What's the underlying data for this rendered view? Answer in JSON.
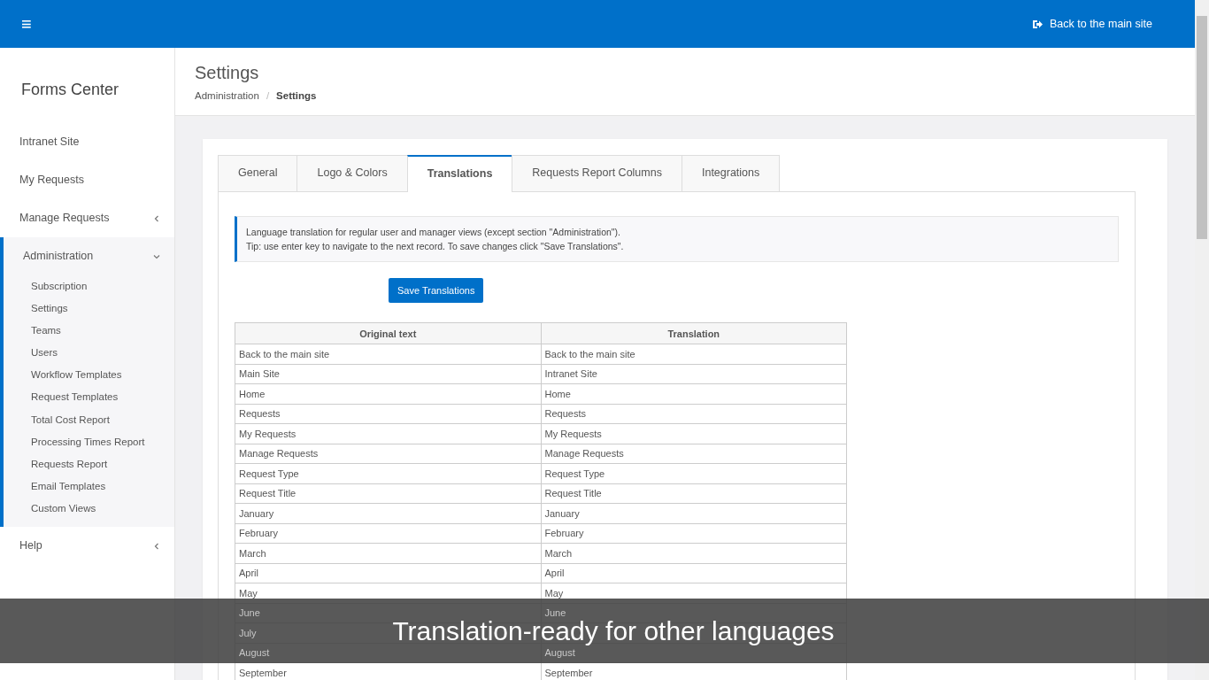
{
  "topbar": {
    "menu_icon": "≡",
    "back_link": "Back to the main site"
  },
  "sidebar": {
    "brand": "Forms Center",
    "items": [
      {
        "label": "Intranet Site",
        "expandable": false,
        "expanded": false
      },
      {
        "label": "My Requests",
        "expandable": false,
        "expanded": false
      },
      {
        "label": "Manage Requests",
        "expandable": true,
        "expanded": false
      },
      {
        "label": "Administration",
        "expandable": true,
        "expanded": true,
        "children": [
          {
            "label": "Subscription"
          },
          {
            "label": "Settings"
          },
          {
            "label": "Teams"
          },
          {
            "label": "Users"
          },
          {
            "label": "Workflow Templates"
          },
          {
            "label": "Request Templates"
          },
          {
            "label": "Total Cost Report"
          },
          {
            "label": "Processing Times Report"
          },
          {
            "label": "Requests Report"
          },
          {
            "label": "Email Templates"
          },
          {
            "label": "Custom Views"
          }
        ]
      },
      {
        "label": "Help",
        "expandable": true,
        "expanded": false
      }
    ]
  },
  "page": {
    "title": "Settings",
    "breadcrumb_separator": "/",
    "breadcrumb": [
      {
        "label": "Administration",
        "current": false
      },
      {
        "label": "Settings",
        "current": true
      }
    ]
  },
  "tabs": [
    {
      "label": "General",
      "selected": false
    },
    {
      "label": "Logo & Colors",
      "selected": false
    },
    {
      "label": "Translations",
      "selected": true
    },
    {
      "label": "Requests Report Columns",
      "selected": false
    },
    {
      "label": "Integrations",
      "selected": false
    }
  ],
  "info": [
    "Language translation for regular user and manager views (except section \"Administration\").",
    "Tip: use enter key to navigate to the next record. To save changes click \"Save Translations\"."
  ],
  "save_button": "Save Translations",
  "table": {
    "columns": [
      "Original text",
      "Translation"
    ],
    "rows": [
      {
        "original": "Back to the main site",
        "translation": "Back to the main site",
        "covered": false
      },
      {
        "original": "Main Site",
        "translation": "Intranet Site",
        "covered": false
      },
      {
        "original": "Home",
        "translation": "Home",
        "covered": false
      },
      {
        "original": "Requests",
        "translation": "Requests",
        "covered": false
      },
      {
        "original": "My Requests",
        "translation": "My Requests",
        "covered": false
      },
      {
        "original": "Manage Requests",
        "translation": "Manage Requests",
        "covered": false
      },
      {
        "original": "Request Type",
        "translation": "Request Type",
        "covered": false
      },
      {
        "original": "Request Title",
        "translation": "Request Title",
        "covered": false
      },
      {
        "original": "January",
        "translation": "January",
        "covered": false
      },
      {
        "original": "February",
        "translation": "February",
        "covered": false
      },
      {
        "original": "March",
        "translation": "March",
        "covered": false
      },
      {
        "original": "April",
        "translation": "April",
        "covered": false
      },
      {
        "original": "May",
        "translation": "May",
        "covered": false
      },
      {
        "original": "June",
        "translation": "June",
        "covered": true
      },
      {
        "original": "July",
        "covered": true
      },
      {
        "original": "August",
        "translation": "August",
        "covered": true
      },
      {
        "original": "September",
        "translation": "September",
        "covered": false
      }
    ]
  },
  "caption": "Translation-ready for other languages"
}
